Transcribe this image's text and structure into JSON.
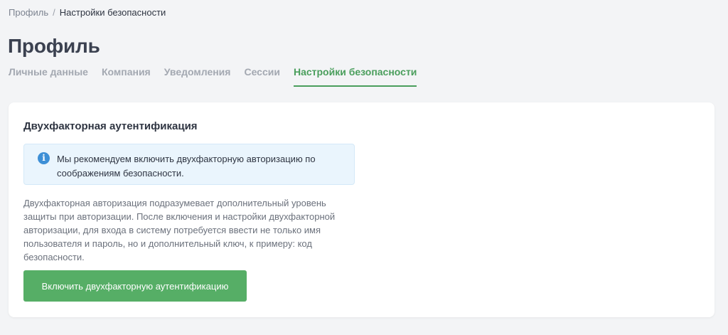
{
  "breadcrumb": {
    "parent": "Профиль",
    "separator": "/",
    "current": "Настройки безопасности"
  },
  "page": {
    "title": "Профиль"
  },
  "tabs": [
    {
      "label": "Личные данные",
      "active": false
    },
    {
      "label": "Компания",
      "active": false
    },
    {
      "label": "Уведомления",
      "active": false
    },
    {
      "label": "Сессии",
      "active": false
    },
    {
      "label": "Настройки безопасности",
      "active": true
    }
  ],
  "two_factor": {
    "title": "Двухфакторная аутентификация",
    "alert": {
      "icon": "info-icon",
      "icon_glyph": "i",
      "text": "Мы рекомендуем включить двухфакторную авторизацию по соображениям безопасности."
    },
    "description": "Двухфакторная авторизация подразумевает дополнительный уровень защиты при авторизации. После включения и настройки двухфакторной авторизации, для входа в систему потребуется ввести не только имя пользователя и пароль, но и дополнительный ключ, к примеру: код безопасности.",
    "button_label": "Включить двухфакторную аутентификацию"
  },
  "colors": {
    "accent": "#4a9e5c",
    "button": "#56ae66",
    "info": "#3d8fd6",
    "alert_background": "#eaf5fd",
    "page_background": "#f3f4f6"
  }
}
